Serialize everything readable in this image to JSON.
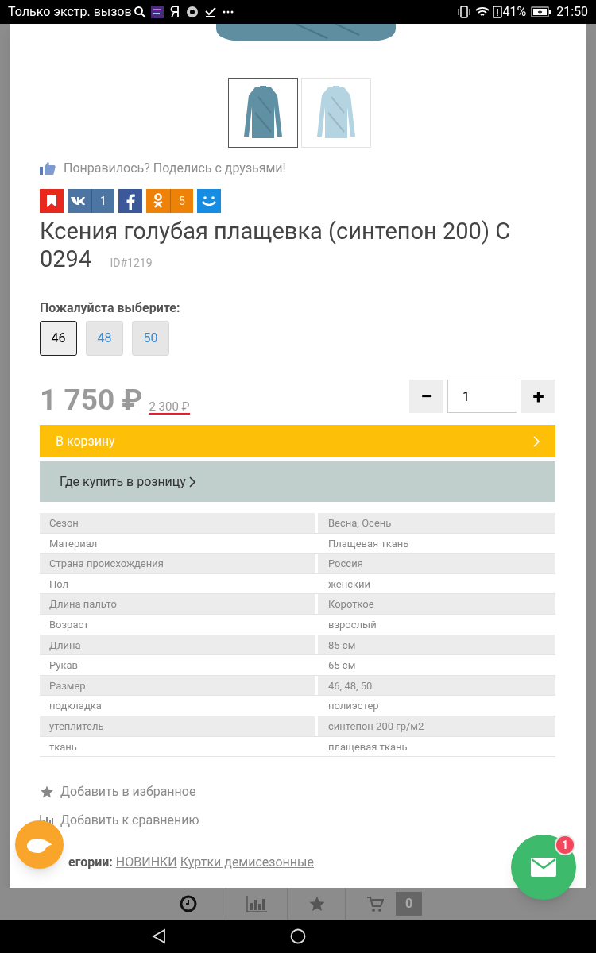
{
  "status_bar": {
    "carrier": "Только экстр. вызов",
    "battery": "41%",
    "time": "21:50"
  },
  "gallery": {
    "thumbnails": [
      {
        "selected": true
      },
      {
        "selected": false
      }
    ]
  },
  "share": {
    "prompt": "Понравилось? Поделись с друзьями!",
    "buttons": [
      {
        "kind": "bookmark",
        "color": "#e8281c"
      },
      {
        "kind": "vk",
        "color": "#4c75a3",
        "count": "1"
      },
      {
        "kind": "facebook",
        "color": "#3b5998"
      },
      {
        "kind": "ok",
        "color": "#ee8208",
        "count": "5"
      },
      {
        "kind": "smile",
        "color": "#168de2"
      }
    ]
  },
  "product": {
    "title": "Ксения голубая плащевка (синтепон 200) С 0294",
    "id": "ID#1219"
  },
  "sizes": {
    "label": "Пожалуйста выберите:",
    "options": [
      {
        "label": "46",
        "selected": true
      },
      {
        "label": "48",
        "selected": false
      },
      {
        "label": "50",
        "selected": false
      }
    ]
  },
  "price": {
    "current": "1 750 ₽",
    "old": "2 300 ₽"
  },
  "quantity": {
    "minus": "−",
    "value": "1",
    "plus": "+"
  },
  "cart_button": "В корзину",
  "retail_button": "Где купить в розницу",
  "specs": [
    {
      "name": "Сезон",
      "value": "Весна, Осень"
    },
    {
      "name": "Материал",
      "value": "Плащевая ткань"
    },
    {
      "name": "Страна происхождения",
      "value": "Россия"
    },
    {
      "name": "Пол",
      "value": "женский"
    },
    {
      "name": "Длина пальто",
      "value": "Короткое"
    },
    {
      "name": "Возраст",
      "value": "взрослый"
    },
    {
      "name": "Длина",
      "value": "85 см"
    },
    {
      "name": "Рукав",
      "value": "65 см"
    },
    {
      "name": "Размер",
      "value": "46, 48, 50"
    },
    {
      "name": "подкладка",
      "value": "полиэстер"
    },
    {
      "name": "утеплитель",
      "value": "синтепон 200 гр/м2"
    },
    {
      "name": "ткань",
      "value": "плащевая ткань"
    }
  ],
  "actions": [
    {
      "kind": "favorite",
      "label": "Добавить в избранное"
    },
    {
      "kind": "compare",
      "label": "Добавить к сравнению"
    }
  ],
  "categories": {
    "label": "егории:",
    "links": [
      "НОВИНКИ",
      "Куртки демисезонные"
    ]
  },
  "chat_badge": "1",
  "bottom_bar": {
    "cart_count": "0"
  }
}
